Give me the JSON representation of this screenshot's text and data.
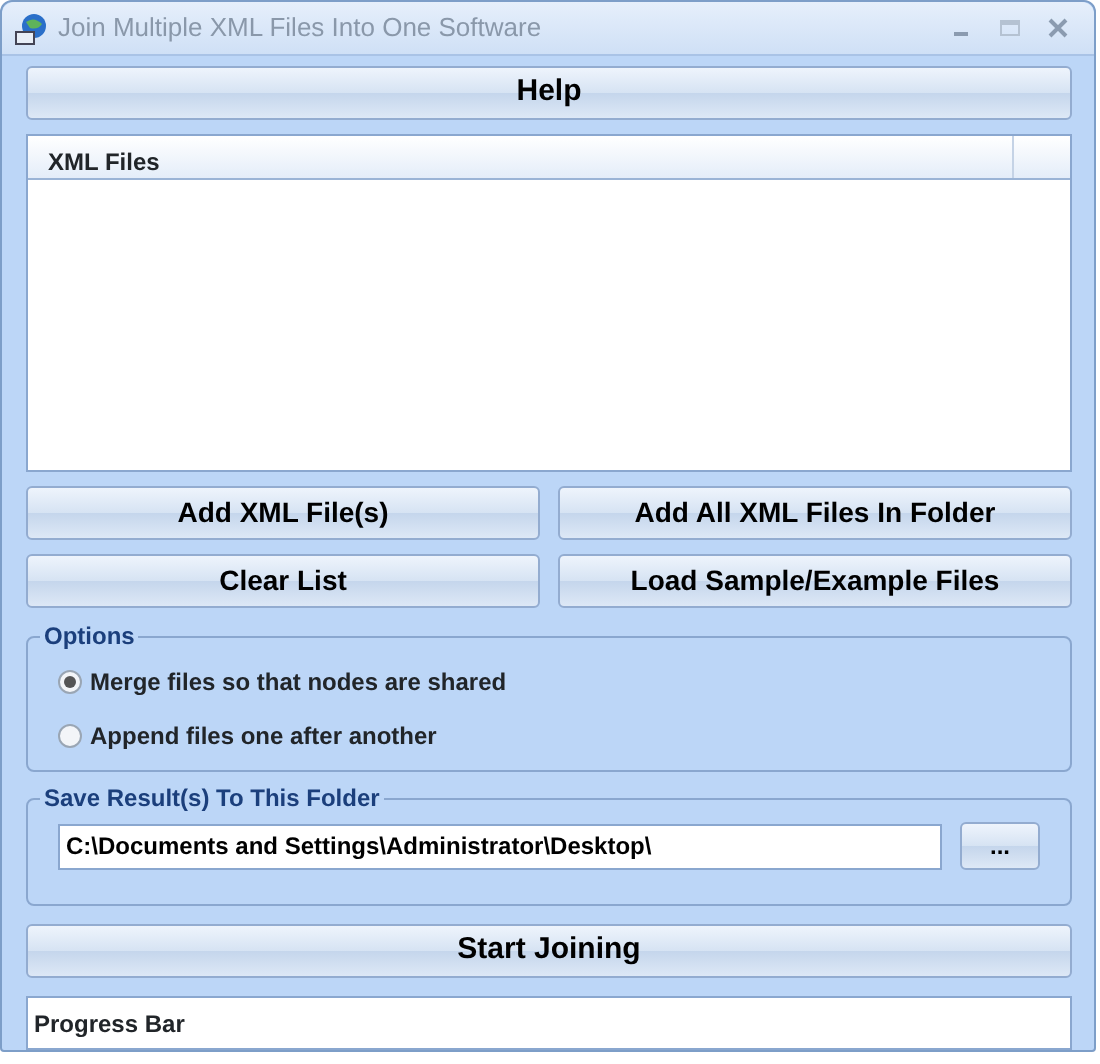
{
  "window": {
    "title": "Join Multiple XML Files Into One Software"
  },
  "help_button": "Help",
  "file_list": {
    "columns": [
      "XML Files"
    ]
  },
  "buttons": [
    "Add XML File(s)",
    "Add All XML Files In Folder",
    "Clear List",
    "Load Sample/Example Files"
  ],
  "options": {
    "title": "Options",
    "items": [
      {
        "label": "Merge files so that nodes are shared",
        "selected": true
      },
      {
        "label": "Append files one after another",
        "selected": false
      }
    ]
  },
  "save_folder": {
    "title": "Save Result(s) To This Folder",
    "value": "C:\\Documents and Settings\\Administrator\\Desktop\\",
    "browse": "..."
  },
  "start_button": "Start Joining",
  "progress": {
    "label": "Progress Bar"
  }
}
